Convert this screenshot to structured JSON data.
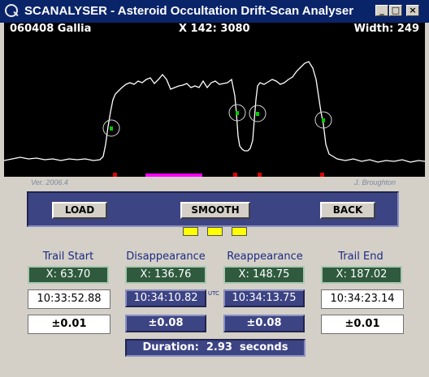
{
  "window": {
    "title": "SCANALYSER - Asteroid Occultation Drift-Scan Analyser",
    "controls": {
      "minimize": "_",
      "maximize": "□",
      "close": "×"
    }
  },
  "plot": {
    "object_label": "060408 Gallia",
    "position_label": "X 142: 3080",
    "width_label": "Width: 249",
    "version": "Ver. 2006.4",
    "author": "J. Broughton",
    "trace_color": "#ffffff",
    "marker_color": "#00cc00",
    "tick_color": "#e00000",
    "bar_color": "#ff00ff"
  },
  "toolbar": {
    "load": "LOAD",
    "smooth": "SMOOTH",
    "back": "BACK"
  },
  "columns": {
    "trail_start": {
      "header": "Trail Start",
      "x": "X:  63.70",
      "time": "10:33:52.88",
      "error": "±0.01"
    },
    "disappearance": {
      "header": "Disappearance",
      "x": "X:  136.76",
      "time": "10:34:10.82",
      "error": "±0.08"
    },
    "reappearance": {
      "header": "Reappearance",
      "x": "X:  148.75",
      "time": "10:34:13.75",
      "error": "±0.08"
    },
    "trail_end": {
      "header": "Trail End",
      "x": "X:  187.02",
      "time": "10:34:23.14",
      "error": "±0.01"
    }
  },
  "utc_label": "UTC",
  "duration": "Duration:  2.93  seconds"
}
